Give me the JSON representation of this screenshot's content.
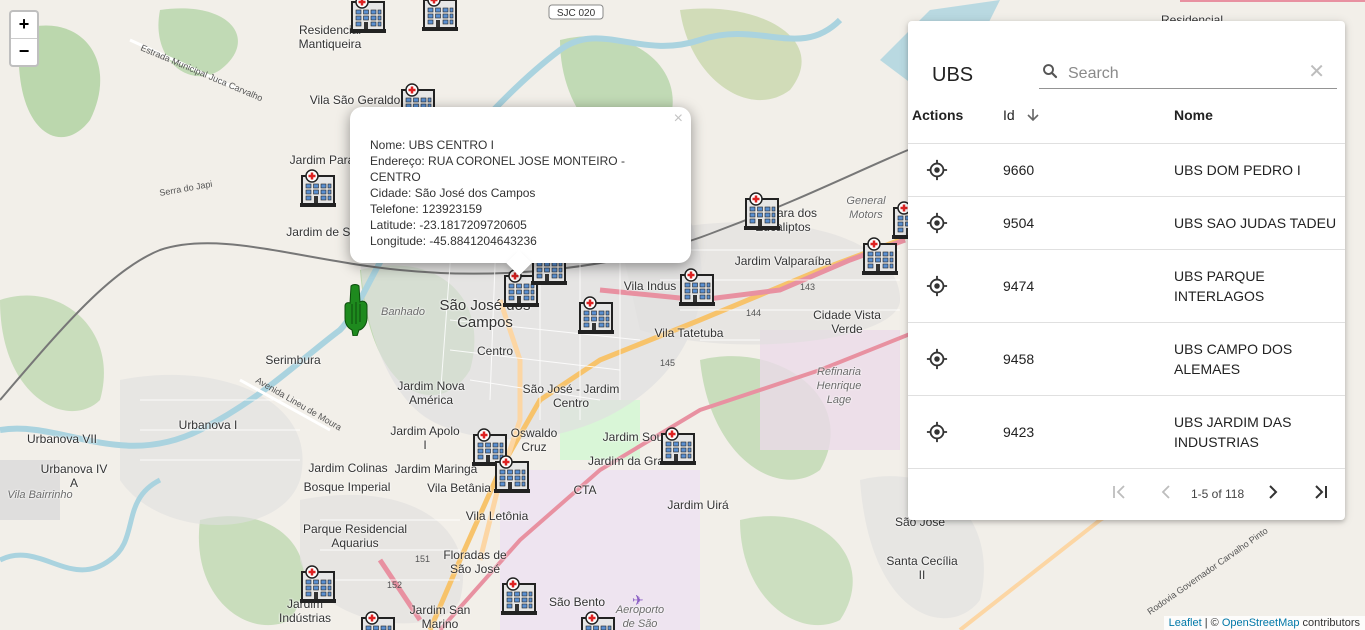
{
  "map": {
    "places": [
      {
        "name": "Residencial\nMantiqueira",
        "cls": ""
      },
      {
        "name": "Vila São Geraldo",
        "cls": ""
      },
      {
        "name": "Jardim Paraíso",
        "cls": ""
      },
      {
        "name": "Jardim de Santa",
        "cls": ""
      },
      {
        "name": "São José dos\nCampos",
        "cls": "big"
      },
      {
        "name": "Centro",
        "cls": ""
      },
      {
        "name": "Banhado",
        "cls": "it"
      },
      {
        "name": "Serimbura",
        "cls": ""
      },
      {
        "name": "Jardim Nova\nAmérica",
        "cls": ""
      },
      {
        "name": "São José - Jardim\nCentro",
        "cls": ""
      },
      {
        "name": "Jardim Apolo\nI",
        "cls": ""
      },
      {
        "name": "Urbanova I",
        "cls": ""
      },
      {
        "name": "Urbanova VII",
        "cls": ""
      },
      {
        "name": "Urbanova IV\nA",
        "cls": ""
      },
      {
        "name": "Vila Bairrinho",
        "cls": "it"
      },
      {
        "name": "Jardim Colinas",
        "cls": ""
      },
      {
        "name": "Jardim Maringá",
        "cls": ""
      },
      {
        "name": "Bosque Imperial",
        "cls": ""
      },
      {
        "name": "Vila Betânia",
        "cls": ""
      },
      {
        "name": "Vila Letônia",
        "cls": ""
      },
      {
        "name": "Parque Residencial\nAquarius",
        "cls": ""
      },
      {
        "name": "Floradas de\nSão José",
        "cls": ""
      },
      {
        "name": "Jardim\nIndústrias",
        "cls": ""
      },
      {
        "name": "Jardim San\nMarino",
        "cls": ""
      },
      {
        "name": "São Bento",
        "cls": ""
      },
      {
        "name": "Jardim Sou",
        "cls": ""
      },
      {
        "name": "Jardim da Gra",
        "cls": ""
      },
      {
        "name": "CTA",
        "cls": ""
      },
      {
        "name": "Jardim Uirá",
        "cls": ""
      },
      {
        "name": "Vila Indus",
        "cls": ""
      },
      {
        "name": "Vila Tatetuba",
        "cls": ""
      },
      {
        "name": "Jardim Valparaíba",
        "cls": ""
      },
      {
        "name": "Chácara dos\nEucaliptos",
        "cls": ""
      },
      {
        "name": "General\nMotors",
        "cls": "it"
      },
      {
        "name": "Cidade Vista\nVerde",
        "cls": ""
      },
      {
        "name": "Refinaria\nHenrique\nLage",
        "cls": "it"
      },
      {
        "name": "Santa Cecília\nII",
        "cls": ""
      },
      {
        "name": "Residencial",
        "cls": ""
      },
      {
        "name": "Oswaldo\nCruz",
        "cls": ""
      },
      {
        "name": "Aeroporto\nde São",
        "cls": "it"
      },
      {
        "name": "Ca\nSão José",
        "cls": ""
      }
    ],
    "roads": [
      {
        "name": "SJC 020"
      },
      {
        "name": "Estrada Municipal Juca Carvalho"
      },
      {
        "name": "Serra do Japi"
      },
      {
        "name": "Avenida Lineu de Moura"
      },
      {
        "name": "Rodovia Governador Carvalho Pinto"
      },
      {
        "name": "143"
      },
      {
        "name": "144"
      },
      {
        "name": "145"
      },
      {
        "name": "151"
      },
      {
        "name": "152"
      }
    ],
    "markers_count": 18
  },
  "zoom": {
    "in": "+",
    "out": "−"
  },
  "popup": {
    "close": "×",
    "lines": [
      "Nome: UBS CENTRO I",
      "Endereço: RUA CORONEL JOSE MONTEIRO - CENTRO",
      "Cidade: São José dos Campos",
      "Telefone: 123923159",
      "Latitude: -23.1817209720605",
      "Longitude: -45.8841204643236"
    ]
  },
  "attribution": {
    "leaflet": "Leaflet",
    "sep": " | © ",
    "osm": "OpenStreetMap",
    "contrib": " contributors"
  },
  "panel": {
    "title": "UBS",
    "search": {
      "placeholder": "Search",
      "value": "",
      "clear": "✕"
    },
    "columns": {
      "actions": "Actions",
      "id": "Id",
      "nome": "Nome"
    },
    "rows": [
      {
        "id": "9660",
        "nome": "UBS DOM PEDRO I"
      },
      {
        "id": "9504",
        "nome": "UBS SAO JUDAS TADEU"
      },
      {
        "id": "9474",
        "nome": "UBS PARQUE INTERLAGOS"
      },
      {
        "id": "9458",
        "nome": "UBS CAMPO DOS ALEMAES"
      },
      {
        "id": "9423",
        "nome": "UBS JARDIM DAS INDUSTRIAS"
      }
    ],
    "pagination": {
      "info": "1-5 of 118"
    }
  },
  "colors": {
    "accent": "#0078a8",
    "marker_green": "#1e8a1e"
  }
}
